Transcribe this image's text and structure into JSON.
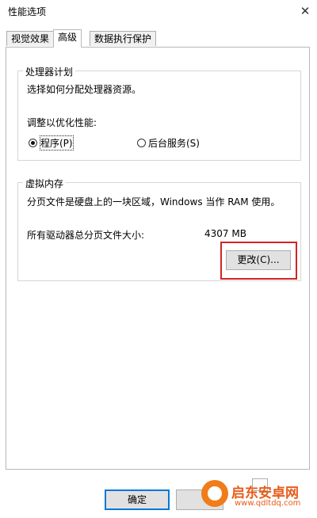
{
  "window": {
    "title": "性能选项",
    "close_glyph": "✕"
  },
  "tabs": [
    {
      "label": "视觉效果",
      "active": false
    },
    {
      "label": "高级",
      "active": true
    },
    {
      "label": "数据执行保护",
      "active": false
    }
  ],
  "processor": {
    "legend": "处理器计划",
    "description": "选择如何分配处理器资源。",
    "adjust_label": "调整以优化性能:",
    "options": [
      {
        "label": "程序(P)",
        "checked": true
      },
      {
        "label": "后台服务(S)",
        "checked": false
      }
    ]
  },
  "virtual_memory": {
    "legend": "虚拟内存",
    "description": "分页文件是硬盘上的一块区域，Windows 当作 RAM 使用。",
    "total_label": "所有驱动器总分页文件大小:",
    "total_value": "4307 MB",
    "change_button": "更改(C)..."
  },
  "footer": {
    "ok_button": "确定"
  },
  "watermark": {
    "title": "启东安卓网",
    "url": "www.qdltdq.com"
  },
  "colors": {
    "highlight": "#d42424",
    "focus_border": "#0078d7",
    "watermark": "#e65c1a"
  }
}
